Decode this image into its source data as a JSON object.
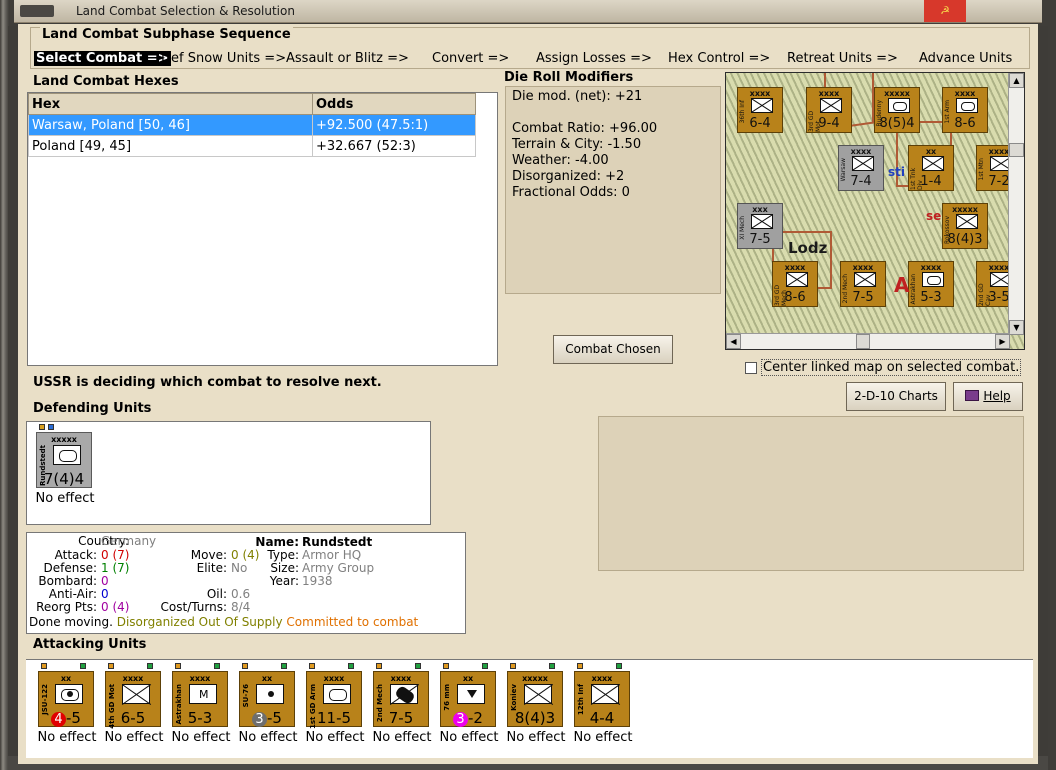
{
  "window": {
    "title": "Land Combat Selection & Resolution",
    "close_glyph": "☭"
  },
  "phase_sequence": {
    "title": "Land Combat Subphase Sequence",
    "steps": [
      "Select Combat =>",
      "Def Snow Units =>",
      "Assault or Blitz =>",
      "Convert =>",
      "Assign Losses =>",
      "Hex Control =>",
      "Retreat Units =>",
      "Advance Units"
    ]
  },
  "hexes": {
    "title": "Land Combat Hexes",
    "columns": [
      "Hex",
      "Odds"
    ],
    "rows": [
      {
        "hex": "Warsaw, Poland [50, 46]",
        "odds": "+92.500 (47.5:1)"
      },
      {
        "hex": "Poland [49, 45]",
        "odds": "+32.667 (52:3)"
      }
    ]
  },
  "die_roll": {
    "title": "Die Roll Modifiers",
    "lines": [
      "Die mod. (net): +21",
      "",
      "Combat Ratio: +96.00",
      "Terrain & City: -1.50",
      "Weather: -4.00",
      "Disorganized: +2",
      "Fractional Odds: 0"
    ]
  },
  "map": {
    "towns": [
      "Lodz",
      "sti",
      "se",
      "A"
    ],
    "counters": [
      {
        "size": "xxxx",
        "value": "6-4",
        "name": "36th Inf"
      },
      {
        "size": "xxxx",
        "value": "9-4",
        "name": "3rd GD Mot"
      },
      {
        "size": "xxxxx",
        "value": "8(5)4",
        "name": "Budenny"
      },
      {
        "size": "xxxx",
        "value": "8-6",
        "name": "1st Arm"
      },
      {
        "size": "xxxx",
        "value": "7-4",
        "name": "Warsaw"
      },
      {
        "size": "xx",
        "value": "1-4",
        "name": "1st Tnk Div"
      },
      {
        "size": "xxxx",
        "value": "7-2",
        "name": "1st Mtn"
      },
      {
        "size": "xxx",
        "value": "7-5",
        "name": "XI Mech"
      },
      {
        "size": "xxxxx",
        "value": "8(4)3",
        "name": "Rokossov"
      },
      {
        "size": "xxxx",
        "value": "8-6",
        "name": "3rd GD Mech"
      },
      {
        "size": "xxxx",
        "value": "7-5",
        "name": "2nd Mech"
      },
      {
        "size": "xxxx",
        "value": "5-3",
        "name": "Astrakhan"
      },
      {
        "size": "xxxx",
        "value": "3-5",
        "name": "2nd GD Cav"
      }
    ]
  },
  "buttons": {
    "combat_chosen": "Combat Chosen",
    "charts": "2-D-10 Charts",
    "help": "Help"
  },
  "center_map_label": "Center linked map on selected combat.",
  "status_message": "USSR is deciding which combat to resolve next.",
  "defending": {
    "title": "Defending Units",
    "units": [
      {
        "size": "xxxxx",
        "value": "7(4)4",
        "name": "Rundstedt",
        "effect": "No effect"
      }
    ]
  },
  "unit_info": {
    "country_label": "Country:",
    "country": "Germany",
    "attack_label": "Attack:",
    "attack": "0",
    "attack_paren": "(7)",
    "defense_label": "Defense:",
    "defense": "1",
    "defense_paren": "(7)",
    "bombard_label": "Bombard:",
    "bombard": "0",
    "antiair_label": "Anti-Air:",
    "antiair": "0",
    "reorg_label": "Reorg Pts:",
    "reorg": "0",
    "reorg_paren": "(4)",
    "done_moving": "Done moving.",
    "flags1": "Disorganized Out Of Supply",
    "flags2": "Committed to combat",
    "move_label": "Move:",
    "move": "0",
    "move_paren": "(4)",
    "elite_label": "Elite:",
    "elite": "No",
    "oil_label": "Oil:",
    "oil": "0.6",
    "cost_label": "Cost/Turns:",
    "cost": "8/4",
    "name_label": "Name:",
    "name": "Rundstedt",
    "type_label": "Type:",
    "type": "Armor HQ",
    "size_label": "Size:",
    "size": "Army Group",
    "year_label": "Year:",
    "year": "1938"
  },
  "attacking": {
    "title": "Attacking Units",
    "units": [
      {
        "size": "xx",
        "v1": "4",
        "v2": "-5",
        "name": "JSU-122",
        "effect": "No effect"
      },
      {
        "size": "xxxx",
        "v1": "6",
        "v2": "-5",
        "name": "4th GD Mot",
        "effect": "No effect"
      },
      {
        "size": "xxxx",
        "v1": "5",
        "v2": "-3",
        "name": "Astrakhan",
        "effect": "No effect"
      },
      {
        "size": "xx",
        "v1": "3",
        "v2": "-5",
        "name": "SU-76",
        "effect": "No effect"
      },
      {
        "size": "xxxx",
        "v1": "11",
        "v2": "-5",
        "name": "1st GD Arm",
        "effect": "No effect"
      },
      {
        "size": "xxxx",
        "v1": "7",
        "v2": "-5",
        "name": "2nd Mech",
        "effect": "No effect"
      },
      {
        "size": "xx",
        "v1": "3",
        "v2": "-2",
        "name": "76 mm",
        "effect": "No effect"
      },
      {
        "size": "xxxxx",
        "v1": "8(4)3",
        "v2": "",
        "name": "Koniev",
        "effect": "No effect"
      },
      {
        "size": "xxxx",
        "v1": "4",
        "v2": "-4",
        "name": "12th Inf",
        "effect": "No effect"
      }
    ]
  },
  "colors": {
    "counter_ussr": "#b8821a",
    "counter_germany": "#a9a9a9",
    "selected_row": "#3399ff"
  }
}
